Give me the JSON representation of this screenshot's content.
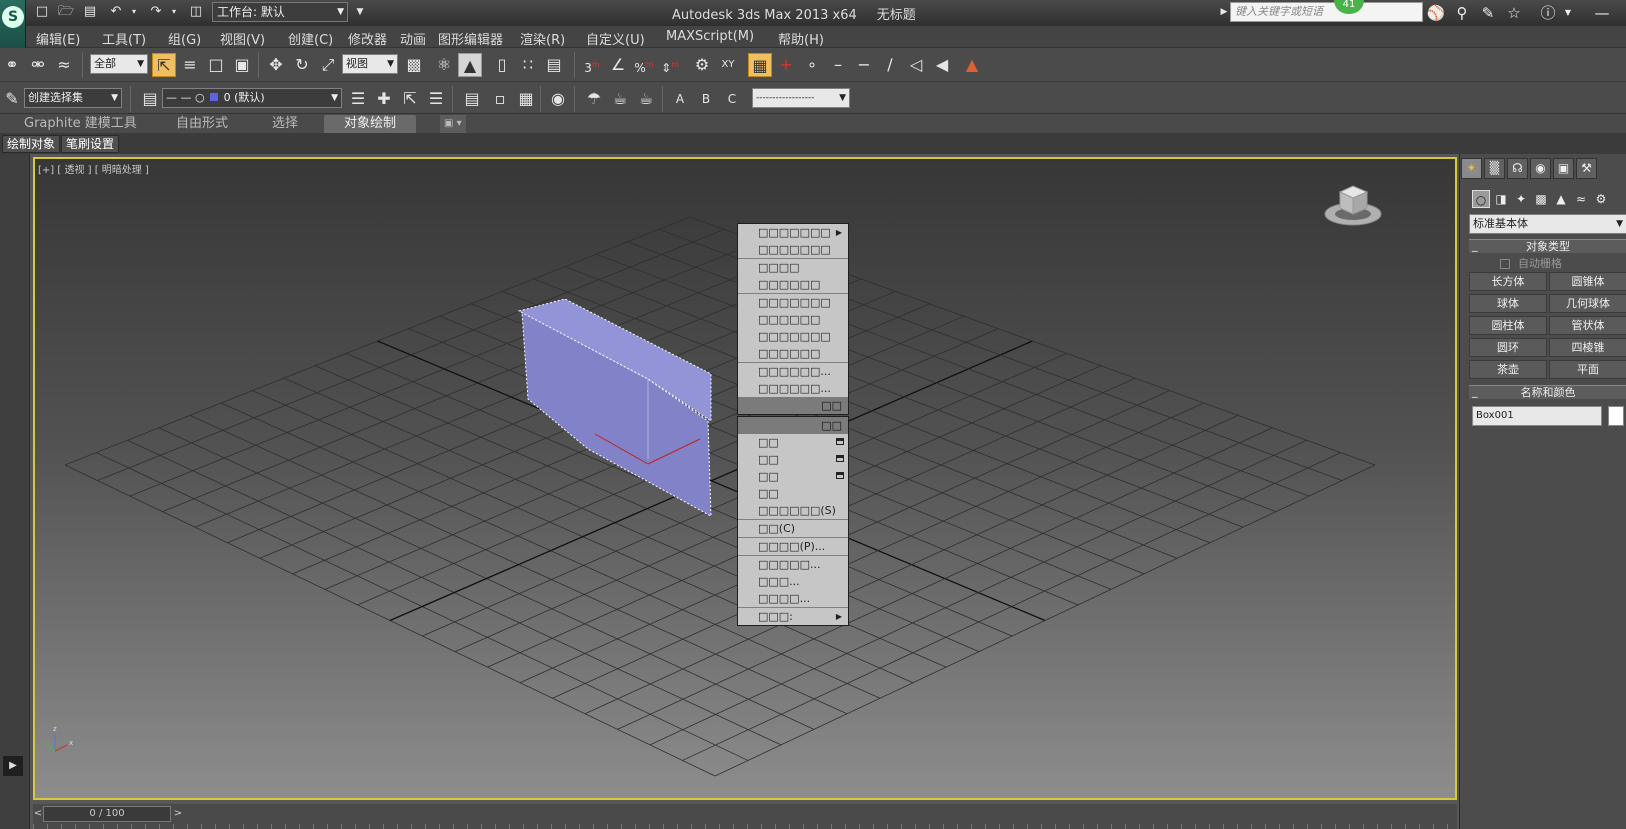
{
  "titlebar": {
    "workspace": "工作台: 默认",
    "app_title": "Autodesk 3ds Max  2013 x64",
    "doc_title": "无标题",
    "search_placeholder": "键入关键字或短语",
    "badge": "41",
    "logo": "S"
  },
  "menubar": [
    "编辑(E)",
    "工具(T)",
    "组(G)",
    "视图(V)",
    "创建(C)",
    "修改器",
    "动画",
    "图形编辑器",
    "渲染(R)",
    "自定义(U)",
    "MAXScript(M)",
    "帮助(H)"
  ],
  "toolbar": {
    "filter": "全部",
    "refcoord": "视图",
    "selection_set": "创建选择集",
    "layer": "0 (默认)",
    "dashes": "------------------"
  },
  "ribbon": {
    "tabs": [
      "Graphite 建模工具",
      "自由形式",
      "选择",
      "对象绘制"
    ],
    "subtabs": [
      "绘制对象",
      "笔刷设置"
    ]
  },
  "viewport": {
    "label": "[+] [ 透视 ] [ 明暗处理 ]",
    "border_color": "#d7c83c"
  },
  "context_menu": {
    "upper": [
      {
        "label": "□□□□□□□",
        "submenu": true
      },
      {
        "label": "□□□□□□□",
        "divider_after": true
      },
      {
        "label": "□□□□"
      },
      {
        "label": "□□□□□□",
        "divider_after": true
      },
      {
        "label": "□□□□□□□"
      },
      {
        "label": "□□□□□□"
      },
      {
        "label": "□□□□□□□"
      },
      {
        "label": "□□□□□□",
        "divider_after": true
      },
      {
        "label": "□□□□□□..."
      },
      {
        "label": "□□□□□□..."
      }
    ],
    "upper_header": "□□",
    "lower_header": "□□",
    "lower": [
      {
        "label": "□□",
        "box": true
      },
      {
        "label": "□□",
        "box": true
      },
      {
        "label": "□□",
        "box": true
      },
      {
        "label": "□□"
      },
      {
        "label": "□□□□□□(S)",
        "divider_after": true
      },
      {
        "label": "□□(C)",
        "divider_after": true
      },
      {
        "label": "□□□□(P)...",
        "divider_after": true
      },
      {
        "label": "□□□□□..."
      },
      {
        "label": "□□□..."
      },
      {
        "label": "□□□□...",
        "divider_after": true
      },
      {
        "label": "□□□:",
        "submenu": true
      }
    ]
  },
  "command_panel": {
    "category": "标准基本体",
    "object_type_title": "对象类型",
    "autogrid": "自动栅格",
    "buttons": [
      "长方体",
      "圆锥体",
      "球体",
      "几何球体",
      "圆柱体",
      "管状体",
      "圆环",
      "四棱锥",
      "茶壶",
      "平面"
    ],
    "name_color_title": "名称和颜色",
    "object_name": "Box001",
    "collapse_symbol": "_"
  },
  "timeline": {
    "frame": "0 / 100",
    "prev": "<",
    "next": ">"
  },
  "icons": {
    "new": "new-file-icon",
    "open": "open-icon",
    "save": "save-icon",
    "undo": "undo-icon",
    "redo": "redo-icon",
    "select_filter": "select-icon",
    "move": "move-icon",
    "rotate": "rotate-icon",
    "scale": "scale-icon",
    "binoculars": "binoculars-icon",
    "star": "star-icon",
    "help": "help-icon"
  },
  "colors": {
    "box_fill": "#8a8ad0",
    "grid_line": "#2e2e2e",
    "accent_selected": "#f0c060"
  }
}
